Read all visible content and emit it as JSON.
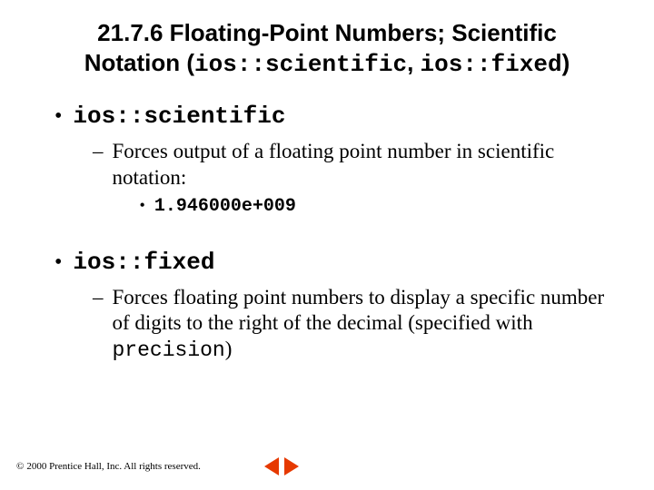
{
  "title": {
    "prefix": "21.7.6  Floating-Point Numbers; Scientific Notation (",
    "code1": "ios::scientific",
    "sep": ", ",
    "code2": "ios::fixed",
    "suffix": ")"
  },
  "items": [
    {
      "label": "ios::scientific",
      "sub": [
        {
          "text": "Forces output of a floating point number in scientific notation:",
          "subsub": [
            {
              "value": "1.946000e+009"
            }
          ]
        }
      ]
    },
    {
      "label": "ios::fixed",
      "sub": [
        {
          "text_parts": {
            "before": "Forces floating point numbers to display a specific number of digits to the right of the decimal (specified with ",
            "code": "precision",
            "after": ")"
          }
        }
      ]
    }
  ],
  "footer": {
    "symbol": "©",
    "text": "2000 Prentice Hall, Inc.  All rights reserved."
  }
}
